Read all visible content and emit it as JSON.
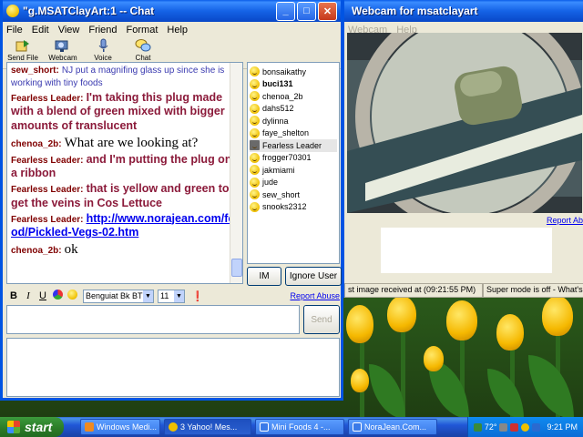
{
  "chat_window": {
    "title": "\"g.MSATClayArt:1 -- Chat",
    "menu": [
      "File",
      "Edit",
      "View",
      "Friend",
      "Format",
      "Help"
    ],
    "toolbar": [
      {
        "label": "Send File",
        "icon": "send-file-icon"
      },
      {
        "label": "Webcam",
        "icon": "webcam-icon"
      },
      {
        "label": "Voice",
        "icon": "voice-icon"
      },
      {
        "label": "Chat",
        "icon": "chat-icon"
      }
    ],
    "messages": [
      {
        "user": "sew_short:",
        "text": "NJ put a magnifing glass up since she is working with tiny foods",
        "name_color": "#800000",
        "text_color": "#3a3ab0",
        "size": "small"
      },
      {
        "user": "Fearless Leader:",
        "text": "I'm taking this plug made with a blend of green mixed with bigger amounts of translucent",
        "name_color": "#800000",
        "text_color": "#8b1a3a",
        "size": "large"
      },
      {
        "user": "chenoa_2b:",
        "text": "What are we looking at?",
        "name_color": "#800000",
        "text_color": "#000000",
        "size": "serif"
      },
      {
        "user": "Fearless Leader:",
        "text": "and I'm putting the plug on a ribbon",
        "name_color": "#800000",
        "text_color": "#8b1a3a",
        "size": "large"
      },
      {
        "user": "Fearless Leader:",
        "text": "that is yellow and green to get the veins in Cos Lettuce",
        "name_color": "#800000",
        "text_color": "#8b1a3a",
        "size": "large"
      },
      {
        "user": "Fearless Leader:",
        "text": "http://www.norajean.com/food/Pickled-Vegs-02.htm",
        "name_color": "#800000",
        "text_color": "#0000ee",
        "size": "link"
      },
      {
        "user": "chenoa_2b:",
        "text": "ok",
        "name_color": "#800000",
        "text_color": "#000000",
        "size": "serif"
      }
    ],
    "users": [
      {
        "name": "bonsaikathy",
        "bold": false,
        "selected": false
      },
      {
        "name": "buci131",
        "bold": true,
        "selected": false
      },
      {
        "name": "chenoa_2b",
        "bold": false,
        "selected": false
      },
      {
        "name": "dahs512",
        "bold": false,
        "selected": false
      },
      {
        "name": "dylinna",
        "bold": false,
        "selected": false
      },
      {
        "name": "faye_shelton",
        "bold": false,
        "selected": false
      },
      {
        "name": "Fearless Leader",
        "bold": false,
        "selected": true
      },
      {
        "name": "frogger70301",
        "bold": false,
        "selected": false
      },
      {
        "name": "jakmiami",
        "bold": false,
        "selected": false
      },
      {
        "name": "jude",
        "bold": false,
        "selected": false
      },
      {
        "name": "sew_short",
        "bold": false,
        "selected": false
      },
      {
        "name": "snooks2312",
        "bold": false,
        "selected": false
      }
    ],
    "im_label": "IM",
    "ignore_label": "Ignore User",
    "format": {
      "bold": "B",
      "italic": "I",
      "underline": "U",
      "font": "Benguiat Bk BT",
      "size": "11"
    },
    "report_abuse": "Report Abuse",
    "send_label": "Send"
  },
  "webcam_window": {
    "title": "Webcam for msatclayart",
    "menu": [
      "Webcam",
      "Help"
    ],
    "report_link": "Report Ab",
    "status_left": "st image received at (09:21:55 PM)",
    "status_right": "Super mode is off - What's th"
  },
  "taskbar": {
    "start_label": "start",
    "tasks": [
      {
        "label": "Windows Medi..."
      },
      {
        "label": "3 Yahoo! Mes..."
      },
      {
        "label": "Mini Foods 4 -..."
      },
      {
        "label": "NoraJean.Com..."
      }
    ],
    "temp": "72°",
    "clock": "9:21 PM"
  }
}
